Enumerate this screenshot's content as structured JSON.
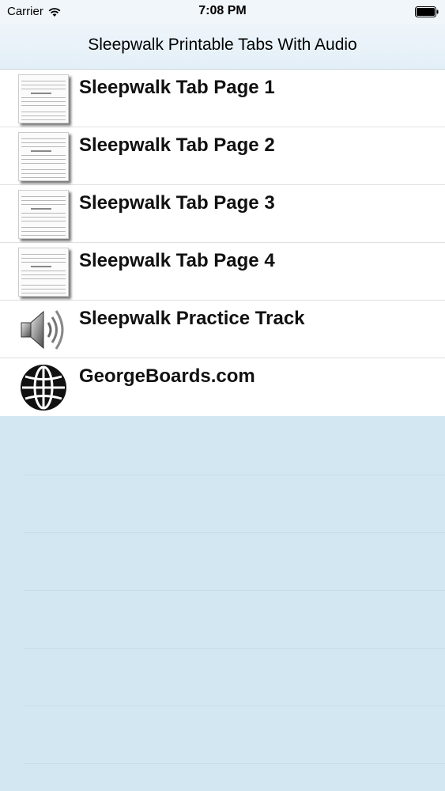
{
  "status_bar": {
    "carrier": "Carrier",
    "time": "7:08 PM",
    "wifi_icon": "wifi-icon",
    "battery_icon": "battery-full-icon"
  },
  "nav": {
    "title": "Sleepwalk Printable Tabs With Audio"
  },
  "list": {
    "items": [
      {
        "label": "Sleepwalk Tab Page 1",
        "icon": "tab-sheet-thumbnail"
      },
      {
        "label": "Sleepwalk Tab Page 2",
        "icon": "tab-sheet-thumbnail"
      },
      {
        "label": "Sleepwalk Tab Page 3",
        "icon": "tab-sheet-thumbnail"
      },
      {
        "label": "Sleepwalk Tab Page 4",
        "icon": "tab-sheet-thumbnail"
      },
      {
        "label": "Sleepwalk Practice Track",
        "icon": "speaker-icon"
      },
      {
        "label": "GeorgeBoards.com",
        "icon": "globe-icon"
      }
    ]
  },
  "colors": {
    "nav_background": "#e8f2f8",
    "empty_background": "#d2e7f1",
    "list_background": "#ffffff"
  }
}
